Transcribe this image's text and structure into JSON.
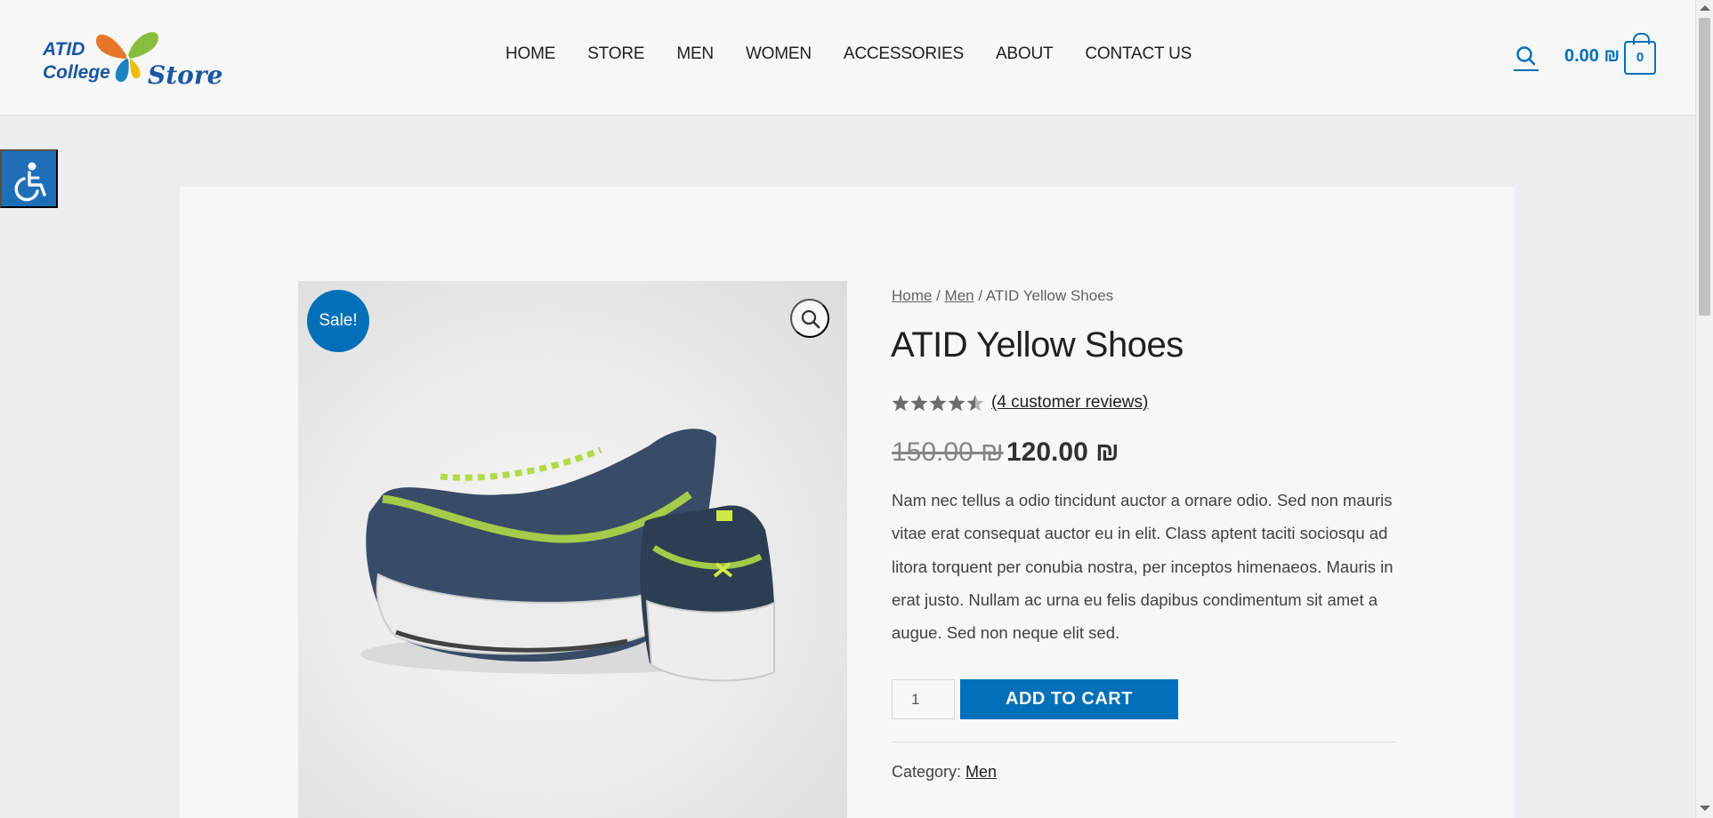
{
  "header": {
    "logo": {
      "line1": "ATID",
      "line2": "College",
      "line3": "Store"
    },
    "nav": [
      "HOME",
      "STORE",
      "MEN",
      "WOMEN",
      "ACCESSORIES",
      "ABOUT",
      "CONTACT US"
    ],
    "search_icon": "search-icon",
    "cart": {
      "amount": "0.00 ₪",
      "count": "0"
    }
  },
  "accessibility": {
    "icon": "wheelchair-icon"
  },
  "product": {
    "sale_badge": "Sale!",
    "zoom_icon": "magnifier-icon",
    "breadcrumb": {
      "home": "Home",
      "sep1": " / ",
      "men": "Men",
      "sep2": " / ",
      "current": "ATID Yellow Shoes"
    },
    "title": "ATID Yellow Shoes",
    "rating": {
      "value": 4.5,
      "max": 5
    },
    "reviews_link": "(4 customer reviews)",
    "price_old": "150.00 ₪",
    "price_new": "120.00 ₪",
    "description": "Nam nec tellus a odio tincidunt auctor a ornare odio. Sed non mauris vitae erat consequat auctor eu in elit. Class aptent taciti sociosqu ad litora torquent per conubia nostra, per inceptos himenaeos. Mauris in erat justo. Nullam ac urna eu felis dapibus condimentum sit amet a augue. Sed non neque elit sed.",
    "quantity": "1",
    "add_to_cart": "ADD TO CART",
    "category_label": "Category: ",
    "category_value": "Men"
  },
  "colors": {
    "accent": "#0274be",
    "a11y": "#1e73be"
  }
}
